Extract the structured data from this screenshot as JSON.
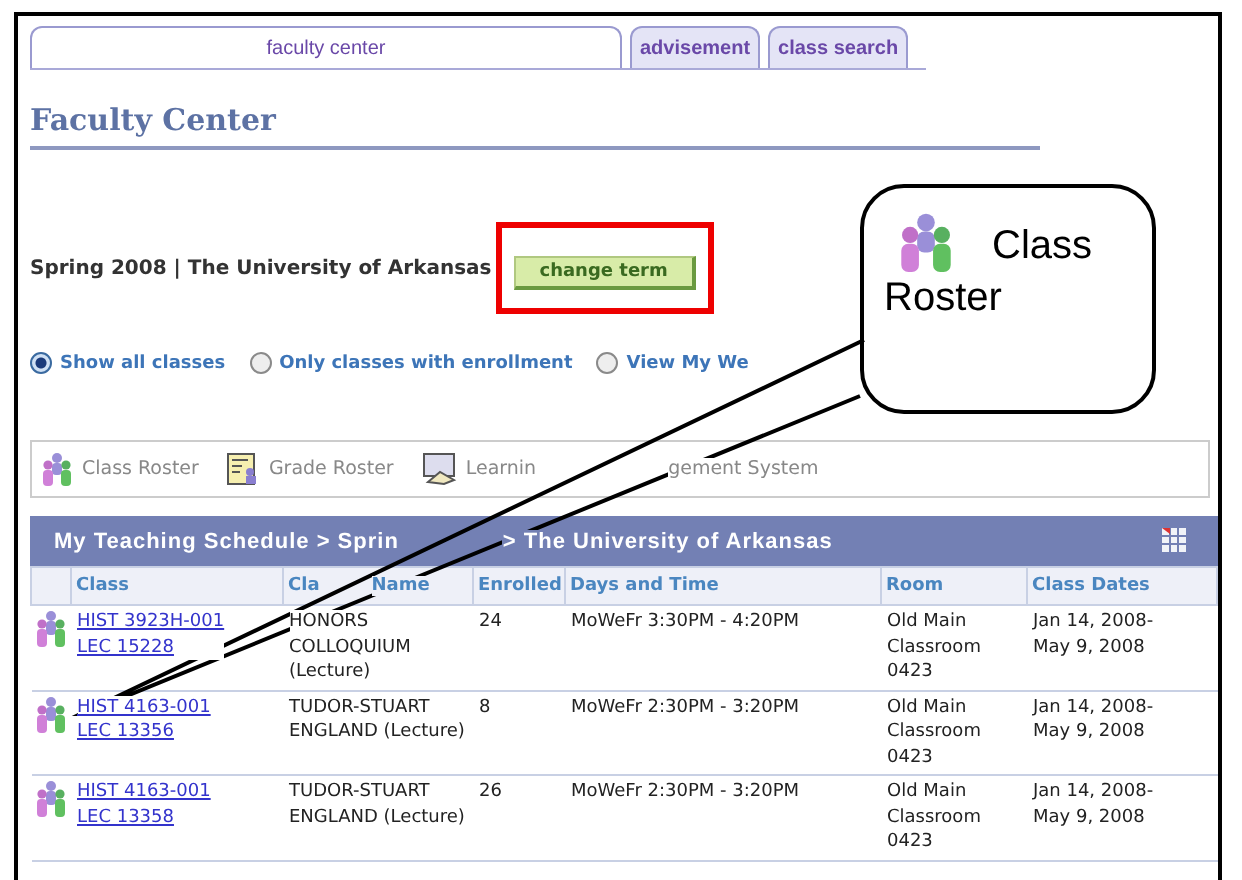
{
  "tabs": [
    {
      "label": "faculty center",
      "selected": true
    },
    {
      "label": "advisement",
      "selected": false
    },
    {
      "label": "class search",
      "selected": false
    }
  ],
  "title": "Faculty Center",
  "term": {
    "text": "Spring 2008 | The University of Arkansas",
    "button": "change term"
  },
  "filters": [
    {
      "label": "Show all classes",
      "selected": true
    },
    {
      "label": "Only classes with enrollment",
      "selected": false
    },
    {
      "label": "View My We",
      "selected": false
    }
  ],
  "toolbar": [
    {
      "kind": "roster",
      "parts": [
        "Class Roster"
      ]
    },
    {
      "kind": "grade",
      "parts": [
        "Grade Roster"
      ]
    },
    {
      "kind": "lms",
      "parts": [
        "Learnin",
        "gement System"
      ]
    }
  ],
  "schedule": {
    "breadcrumb": [
      "My Teaching Schedule > Sprin",
      "> The University of Arkansas"
    ],
    "columns": [
      {
        "parts": [
          "Class"
        ]
      },
      {
        "parts": [
          "Cla",
          "Name"
        ]
      },
      {
        "parts": [
          "Enrolled"
        ]
      },
      {
        "parts": [
          "Days and Time"
        ]
      },
      {
        "parts": [
          "Room"
        ]
      },
      {
        "parts": [
          "Class Dates"
        ]
      }
    ],
    "rows": [
      {
        "class": [
          "HIST 3923H-001",
          "LEC 15228"
        ],
        "name": [
          "HONORS",
          "COLLOQUIUM",
          "(Lecture)"
        ],
        "enrolled": "24",
        "days": "MoWeFr 3:30PM - 4:20PM",
        "room": [
          "Old Main",
          "Classroom",
          "0423"
        ],
        "dates": [
          "Jan 14, 2008-",
          "May 9, 2008"
        ]
      },
      {
        "class": [
          "HIST 4163-001",
          "LEC 13356"
        ],
        "name": [
          "TUDOR-STUART",
          "ENGLAND (Lecture)"
        ],
        "enrolled": "8",
        "days": "MoWeFr 2:30PM - 3:20PM",
        "room": [
          "Old Main",
          "Classroom",
          "0423"
        ],
        "dates": [
          "Jan 14, 2008-",
          "May 9, 2008"
        ]
      },
      {
        "class": [
          "HIST 4163-001",
          "LEC 13358"
        ],
        "name": [
          "TUDOR-STUART",
          "ENGLAND (Lecture)"
        ],
        "enrolled": "26",
        "days": "MoWeFr 2:30PM - 3:20PM",
        "room": [
          "Old Main",
          "Classroom",
          "0423"
        ],
        "dates": [
          "Jan 14, 2008-",
          "May 9, 2008"
        ]
      }
    ]
  },
  "callout": {
    "lines": [
      "Class",
      "Roster"
    ]
  }
}
